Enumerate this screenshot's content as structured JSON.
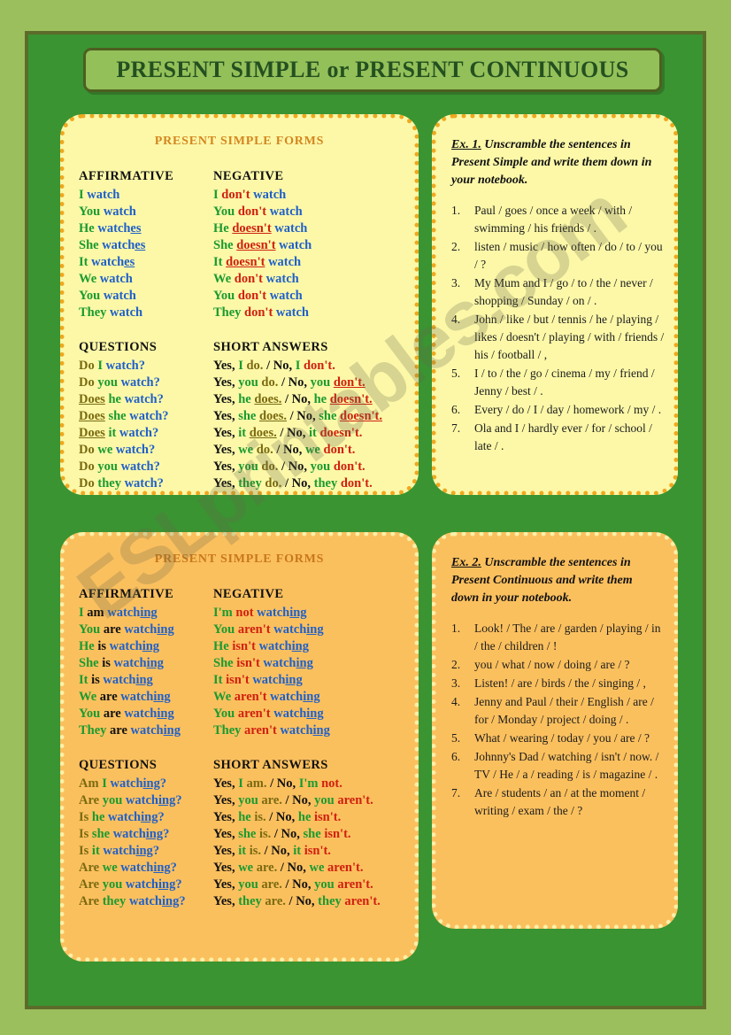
{
  "page": {
    "title": "PRESENT SIMPLE or PRESENT CONTINUOUS",
    "watermark": "ESLprintables.com",
    "colors": {
      "page_background": "#9cbf5e",
      "frame_green": "#3a9432",
      "frame_border": "#5c6b2a",
      "banner_fill": "#93c059",
      "banner_text": "#245020",
      "card_yellow": "#fcf8a8",
      "card_orange": "#fbc05e",
      "dot_orange": "#f0a81e",
      "dot_yellow": "#fbf0a8",
      "pronoun_green": "#1a9a2f",
      "verb_blue": "#2060c8",
      "negative_red": "#d02010",
      "aux_olive": "#7a6a10",
      "card_title_orange": "#d4861f"
    }
  },
  "present_simple": {
    "title": "PRESENT SIMPLE FORMS",
    "headers": {
      "affirmative": "AFFIRMATIVE",
      "negative": "NEGATIVE",
      "questions": "QUESTIONS",
      "short_answers": "SHORT ANSWERS"
    },
    "affirmative": [
      {
        "pronoun": "I",
        "verb": "watch",
        "verb_suffix": ""
      },
      {
        "pronoun": "You",
        "verb": "watch",
        "verb_suffix": ""
      },
      {
        "pronoun": "He",
        "verb": "watch",
        "verb_suffix": "es"
      },
      {
        "pronoun": "She",
        "verb": "watch",
        "verb_suffix": "es"
      },
      {
        "pronoun": "It",
        "verb": "watch",
        "verb_suffix": "es"
      },
      {
        "pronoun": "We",
        "verb": "watch",
        "verb_suffix": ""
      },
      {
        "pronoun": "You",
        "verb": "watch",
        "verb_suffix": ""
      },
      {
        "pronoun": "They",
        "verb": "watch",
        "verb_suffix": ""
      }
    ],
    "negative": [
      {
        "pronoun": "I",
        "aux": "don't",
        "underline": false,
        "verb": "watch"
      },
      {
        "pronoun": "You",
        "aux": "don't",
        "underline": false,
        "verb": "watch"
      },
      {
        "pronoun": "He",
        "aux": "doesn't",
        "underline": true,
        "verb": "watch"
      },
      {
        "pronoun": "She",
        "aux": "doesn't",
        "underline": true,
        "verb": "watch"
      },
      {
        "pronoun": "It",
        "aux": "doesn't",
        "underline": true,
        "verb": "watch"
      },
      {
        "pronoun": "We",
        "aux": "don't",
        "underline": false,
        "verb": "watch"
      },
      {
        "pronoun": "You",
        "aux": "don't",
        "underline": false,
        "verb": "watch"
      },
      {
        "pronoun": "They",
        "aux": "don't",
        "underline": false,
        "verb": "watch"
      }
    ],
    "questions": [
      {
        "aux": "Do",
        "underline": false,
        "pronoun": "I",
        "verb": "watch?"
      },
      {
        "aux": "Do",
        "underline": false,
        "pronoun": "you",
        "verb": "watch?"
      },
      {
        "aux": "Does",
        "underline": true,
        "pronoun": "he",
        "verb": "watch?"
      },
      {
        "aux": "Does",
        "underline": true,
        "pronoun": "she",
        "verb": "watch?"
      },
      {
        "aux": "Does",
        "underline": true,
        "pronoun": "it",
        "verb": "watch?"
      },
      {
        "aux": "Do",
        "underline": false,
        "pronoun": "we",
        "verb": "watch?"
      },
      {
        "aux": "Do",
        "underline": false,
        "pronoun": "you",
        "verb": "watch?"
      },
      {
        "aux": "Do",
        "underline": false,
        "pronoun": "they",
        "verb": "watch?"
      }
    ],
    "short_answers": [
      {
        "yes": "Yes,",
        "yp": "I",
        "ya": "do.",
        "yu": false,
        "sep": "/ No,",
        "np": "I",
        "na": "don't.",
        "nu": false
      },
      {
        "yes": "Yes,",
        "yp": "you",
        "ya": "do.",
        "yu": false,
        "sep": "/ No,",
        "np": "you",
        "na": "don't.",
        "nu": true
      },
      {
        "yes": "Yes,",
        "yp": "he",
        "ya": "does.",
        "yu": true,
        "sep": "/ No,",
        "np": "he",
        "na": "doesn't.",
        "nu": true
      },
      {
        "yes": "Yes,",
        "yp": "she",
        "ya": "does.",
        "yu": true,
        "sep": "/ No,",
        "np": "she",
        "na": "doesn't.",
        "nu": true
      },
      {
        "yes": "Yes,",
        "yp": "it",
        "ya": "does.",
        "yu": true,
        "sep": "/ No,",
        "np": "it",
        "na": "doesn't.",
        "nu": false
      },
      {
        "yes": "Yes,",
        "yp": "we",
        "ya": "do.",
        "yu": false,
        "sep": "/ No,",
        "np": "we",
        "na": "don't.",
        "nu": false
      },
      {
        "yes": "Yes,",
        "yp": "you",
        "ya": "do.",
        "yu": false,
        "sep": "/ No,",
        "np": "you",
        "na": "don't.",
        "nu": false
      },
      {
        "yes": "Yes,",
        "yp": "they",
        "ya": "do.",
        "yu": false,
        "sep": "/ No,",
        "np": "they",
        "na": "don't.",
        "nu": false
      }
    ]
  },
  "present_continuous": {
    "title": "PRESENT SIMPLE FORMS",
    "headers": {
      "affirmative": "AFFIRMATIVE",
      "negative": "NEGATIVE",
      "questions": "QUESTIONS",
      "short_answers": "SHORT ANSWERS"
    },
    "affirmative": [
      {
        "pronoun": "I",
        "be": "am",
        "verb": "watch",
        "verb_suffix": "ing"
      },
      {
        "pronoun": "You",
        "be": "are",
        "verb": "watch",
        "verb_suffix": "ing"
      },
      {
        "pronoun": "He",
        "be": "is",
        "verb": "watch",
        "verb_suffix": "ing"
      },
      {
        "pronoun": "She",
        "be": "is",
        "verb": "watch",
        "verb_suffix": "ing"
      },
      {
        "pronoun": "It",
        "be": "is",
        "verb": "watch",
        "verb_suffix": "ing"
      },
      {
        "pronoun": "We",
        "be": "are",
        "verb": "watch",
        "verb_suffix": "ing"
      },
      {
        "pronoun": "You",
        "be": "are",
        "verb": "watch",
        "verb_suffix": "ing"
      },
      {
        "pronoun": "They",
        "be": "are",
        "verb": "watch",
        "verb_suffix": "ing"
      }
    ],
    "negative": [
      {
        "pronoun": "I'm",
        "aux": "not",
        "verb": "watch",
        "verb_suffix": "ing"
      },
      {
        "pronoun": "You",
        "aux": "aren't",
        "verb": "watch",
        "verb_suffix": "ing"
      },
      {
        "pronoun": "He",
        "aux": "isn't",
        "verb": "watch",
        "verb_suffix": "ing"
      },
      {
        "pronoun": "She",
        "aux": "isn't",
        "verb": "watch",
        "verb_suffix": "ing"
      },
      {
        "pronoun": "It",
        "aux": "isn't",
        "verb": "watch",
        "verb_suffix": "ing"
      },
      {
        "pronoun": "We",
        "aux": "aren't",
        "verb": "watch",
        "verb_suffix": "ing"
      },
      {
        "pronoun": "You",
        "aux": "aren't",
        "verb": "watch",
        "verb_suffix": "ing"
      },
      {
        "pronoun": "They",
        "aux": "aren't",
        "verb": "watch",
        "verb_suffix": "ing"
      }
    ],
    "questions": [
      {
        "aux": "Am",
        "pronoun": "I",
        "verb": "watch",
        "verb_suffix": "ing",
        "tail": "?"
      },
      {
        "aux": "Are",
        "pronoun": "you",
        "verb": "watch",
        "verb_suffix": "ing",
        "tail": "?"
      },
      {
        "aux": "Is",
        "pronoun": "he",
        "verb": "watch",
        "verb_suffix": "ing",
        "tail": "?"
      },
      {
        "aux": "Is",
        "pronoun": "she",
        "verb": "watch",
        "verb_suffix": "ing",
        "tail": "?"
      },
      {
        "aux": "Is",
        "pronoun": "it",
        "verb": "watch",
        "verb_suffix": "ing",
        "tail": "?"
      },
      {
        "aux": "Are",
        "pronoun": "we",
        "verb": "watch",
        "verb_suffix": "ing",
        "tail": "?"
      },
      {
        "aux": "Are",
        "pronoun": "you",
        "verb": "watch",
        "verb_suffix": "ing",
        "tail": "?"
      },
      {
        "aux": "Are",
        "pronoun": "they",
        "verb": "watch",
        "verb_suffix": "ing",
        "tail": "?"
      }
    ],
    "short_answers": [
      {
        "yes": "Yes,",
        "yp": "I",
        "ya": "am.",
        "sep": "/ No,",
        "np": "I'm",
        "na": "not."
      },
      {
        "yes": "Yes,",
        "yp": "you",
        "ya": "are.",
        "sep": "/ No,",
        "np": "you",
        "na": "aren't."
      },
      {
        "yes": "Yes,",
        "yp": "he",
        "ya": "is.",
        "sep": "/ No,",
        "np": "he",
        "na": "isn't."
      },
      {
        "yes": "Yes,",
        "yp": "she",
        "ya": "is.",
        "sep": "/ No,",
        "np": "she",
        "na": "isn't."
      },
      {
        "yes": "Yes,",
        "yp": "it",
        "ya": "is.",
        "sep": "/ No,",
        "np": "it",
        "na": "isn't."
      },
      {
        "yes": "Yes,",
        "yp": "we",
        "ya": "are.",
        "sep": "/ No,",
        "np": "we",
        "na": "aren't."
      },
      {
        "yes": "Yes,",
        "yp": "you",
        "ya": "are.",
        "sep": "/ No,",
        "np": "you",
        "na": "aren't."
      },
      {
        "yes": "Yes,",
        "yp": "they",
        "ya": "are.",
        "sep": "/ No,",
        "np": "they",
        "na": "aren't."
      }
    ]
  },
  "exercise1": {
    "label": "Ex. 1.",
    "instruction": "Unscramble the sentences in Present Simple and write them down in your notebook.",
    "items": [
      "Paul / goes / once a week / with / swimming / his friends / .",
      "listen / music / how often / do / to / you / ?",
      "My Mum and I /  go / to / the / never / shopping / Sunday / on / .",
      "John / like / but / tennis / he / playing / likes / doesn't /  playing / with / friends / his / football / ,",
      "I / to / the / go / cinema / my / friend / Jenny / best / .",
      "Every / do / I / day / homework / my / .",
      "Ola and I / hardly ever / for / school / late / ."
    ]
  },
  "exercise2": {
    "label": "Ex. 2.",
    "instruction": "Unscramble the sentences in Present Continuous and write them down in your notebook.",
    "items": [
      "Look! / The / are / garden / playing / in / the / children / !",
      "you / what / now / doing / are / ?",
      "Listen! / are / birds / the / singing / ,",
      "Jenny and Paul / their / English / are / for / Monday / project / doing / .",
      "What / wearing / today / you / are / ?",
      "Johnny's Dad / watching / isn't / now. / TV / He / a / reading / is / magazine / .",
      "Are / students / an / at the moment / writing / exam / the / ?"
    ]
  }
}
